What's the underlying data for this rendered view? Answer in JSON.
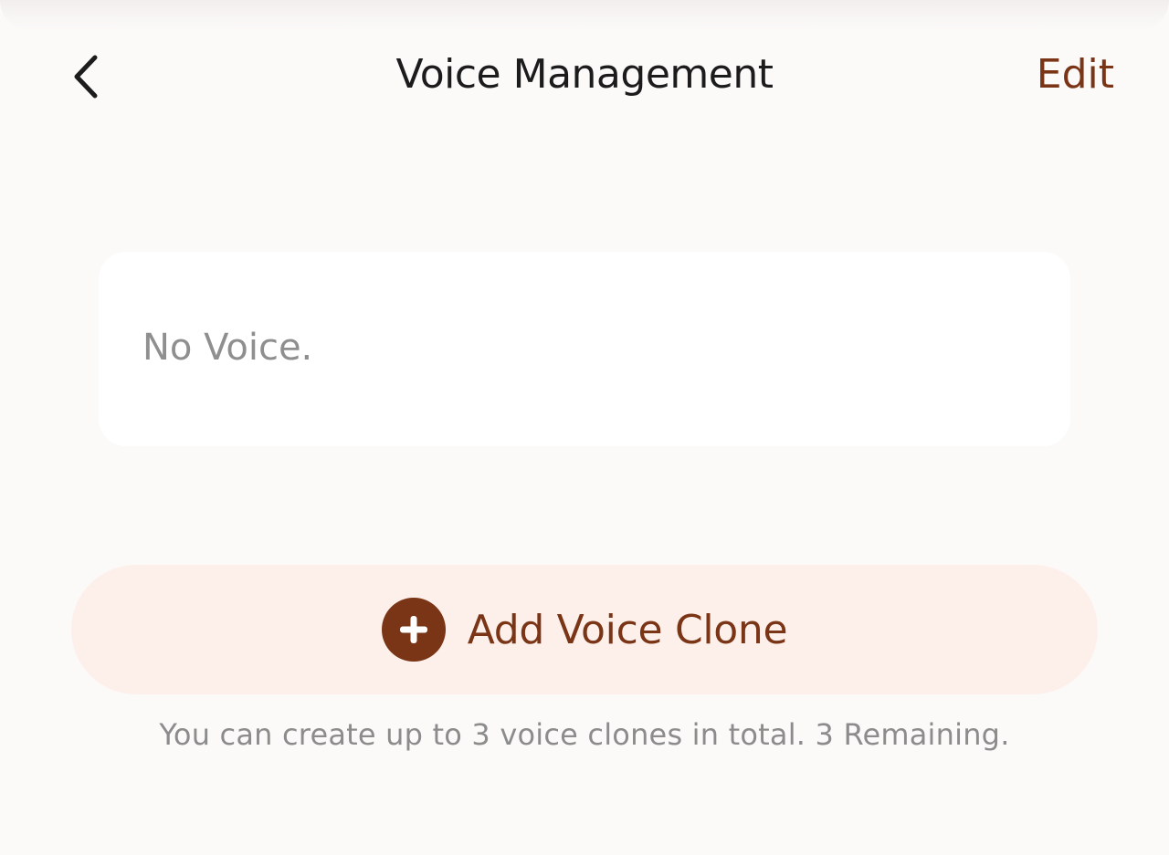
{
  "header": {
    "back_icon": "chevron-left-icon",
    "title": "Voice Management",
    "edit_label": "Edit"
  },
  "voice_list": {
    "empty_text": "No Voice."
  },
  "add_voice": {
    "icon": "plus-circle-icon",
    "label": "Add Voice Clone"
  },
  "hint": {
    "text": "You can create up to 3 voice clones in total. 3 Remaining."
  },
  "colors": {
    "accent": "#7a3416",
    "button_bg": "#fdf0ea",
    "page_bg": "#fcf9f9",
    "card_bg": "#ffffff",
    "muted_text": "#8f8f8f"
  }
}
